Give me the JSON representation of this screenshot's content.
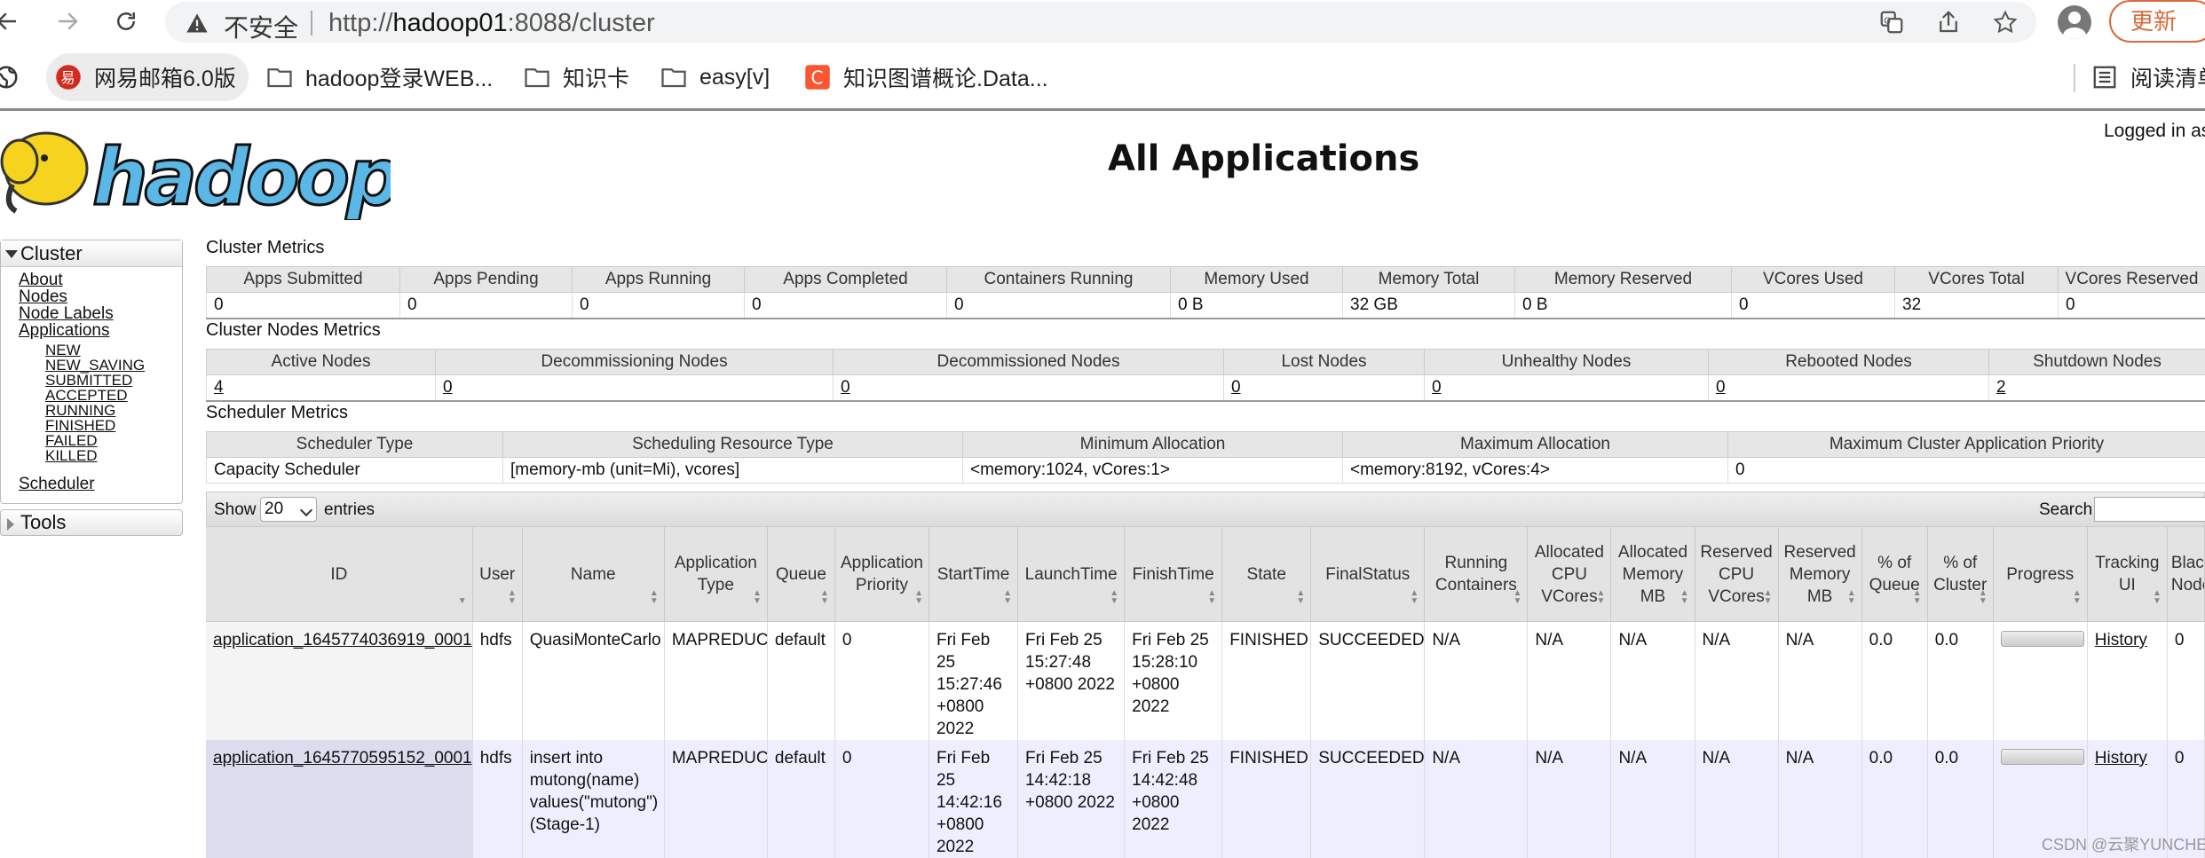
{
  "browser": {
    "insecure_label": "不安全",
    "url_prefix": "http://",
    "url_host": "hadoop01",
    "url_rest": ":8088/cluster",
    "update_label": "更新",
    "bookmarks": [
      {
        "label": "网易邮箱6.0版",
        "icon": "mail-icon"
      },
      {
        "label": "hadoop登录WEB...",
        "icon": "folder-icon"
      },
      {
        "label": "知识卡",
        "icon": "folder-icon"
      },
      {
        "label": "easy[v]",
        "icon": "folder-icon"
      },
      {
        "label": "知识图谱概论.Data...",
        "icon": "csdn-icon"
      }
    ],
    "reading_list_label": "阅读清单"
  },
  "page": {
    "title": "All Applications",
    "logged_in": "Logged in as: dr.who"
  },
  "sidebar": {
    "cluster_label": "Cluster",
    "links": [
      "About",
      "Nodes",
      "Node Labels",
      "Applications"
    ],
    "app_states": [
      "NEW",
      "NEW_SAVING",
      "SUBMITTED",
      "ACCEPTED",
      "RUNNING",
      "FINISHED",
      "FAILED",
      "KILLED"
    ],
    "scheduler_label": "Scheduler",
    "tools_label": "Tools"
  },
  "cluster_metrics": {
    "title": "Cluster Metrics",
    "headers": [
      "Apps Submitted",
      "Apps Pending",
      "Apps Running",
      "Apps Completed",
      "Containers Running",
      "Memory Used",
      "Memory Total",
      "Memory Reserved",
      "VCores Used",
      "VCores Total",
      "VCores Reserved"
    ],
    "values": [
      "0",
      "0",
      "0",
      "0",
      "0",
      "0 B",
      "32 GB",
      "0 B",
      "0",
      "32",
      "0"
    ]
  },
  "nodes_metrics": {
    "title": "Cluster Nodes Metrics",
    "headers": [
      "Active Nodes",
      "Decommissioning Nodes",
      "Decommissioned Nodes",
      "Lost Nodes",
      "Unhealthy Nodes",
      "Rebooted Nodes",
      "Shutdown Nodes"
    ],
    "values": [
      "4",
      "0",
      "0",
      "0",
      "0",
      "0",
      "2"
    ]
  },
  "scheduler_metrics": {
    "title": "Scheduler Metrics",
    "headers": [
      "Scheduler Type",
      "Scheduling Resource Type",
      "Minimum Allocation",
      "Maximum Allocation",
      "Maximum Cluster Application Priority"
    ],
    "values": [
      "Capacity Scheduler",
      "[memory-mb (unit=Mi), vcores]",
      "<memory:1024, vCores:1>",
      "<memory:8192, vCores:4>",
      "0"
    ]
  },
  "apps": {
    "show_label": "Show",
    "page_size": "20",
    "entries_label": "entries",
    "search_label": "Search:",
    "headers": [
      "ID",
      "User",
      "Name",
      "Application Type",
      "Queue",
      "Application Priority",
      "StartTime",
      "LaunchTime",
      "FinishTime",
      "State",
      "FinalStatus",
      "Running Containers",
      "Allocated CPU VCores",
      "Allocated Memory MB",
      "Reserved CPU VCores",
      "Reserved Memory MB",
      "% of Queue",
      "% of Cluster",
      "Progress",
      "Tracking UI",
      "Blacklisted Nodes"
    ],
    "rows": [
      {
        "id": "application_1645774036919_0001",
        "user": "hdfs",
        "name": "QuasiMonteCarlo",
        "type": "MAPREDUCE",
        "queue": "default",
        "priority": "0",
        "start": "Fri Feb 25 15:27:46 +0800 2022",
        "launch": "Fri Feb 25 15:27:48 +0800 2022",
        "finish": "Fri Feb 25 15:28:10 +0800 2022",
        "state": "FINISHED",
        "final_status": "SUCCEEDED",
        "running_containers": "N/A",
        "alloc_vcores": "N/A",
        "alloc_mem": "N/A",
        "res_vcores": "N/A",
        "res_mem": "N/A",
        "pct_queue": "0.0",
        "pct_cluster": "0.0",
        "progress": 1.0,
        "tracking": "History",
        "blacklisted": "0"
      },
      {
        "id": "application_1645770595152_0001",
        "user": "hdfs",
        "name": "insert into mutong(name) values(\"mutong\")(Stage-1)",
        "type": "MAPREDUCE",
        "queue": "default",
        "priority": "0",
        "start": "Fri Feb 25 14:42:16 +0800 2022",
        "launch": "Fri Feb 25 14:42:18 +0800 2022",
        "finish": "Fri Feb 25 14:42:48 +0800 2022",
        "state": "FINISHED",
        "final_status": "SUCCEEDED",
        "running_containers": "N/A",
        "alloc_vcores": "N/A",
        "alloc_mem": "N/A",
        "res_vcores": "N/A",
        "res_mem": "N/A",
        "pct_queue": "0.0",
        "pct_cluster": "0.0",
        "progress": 1.0,
        "tracking": "History",
        "blacklisted": "0"
      }
    ]
  },
  "watermark": "CSDN @云聚YUNCHE"
}
